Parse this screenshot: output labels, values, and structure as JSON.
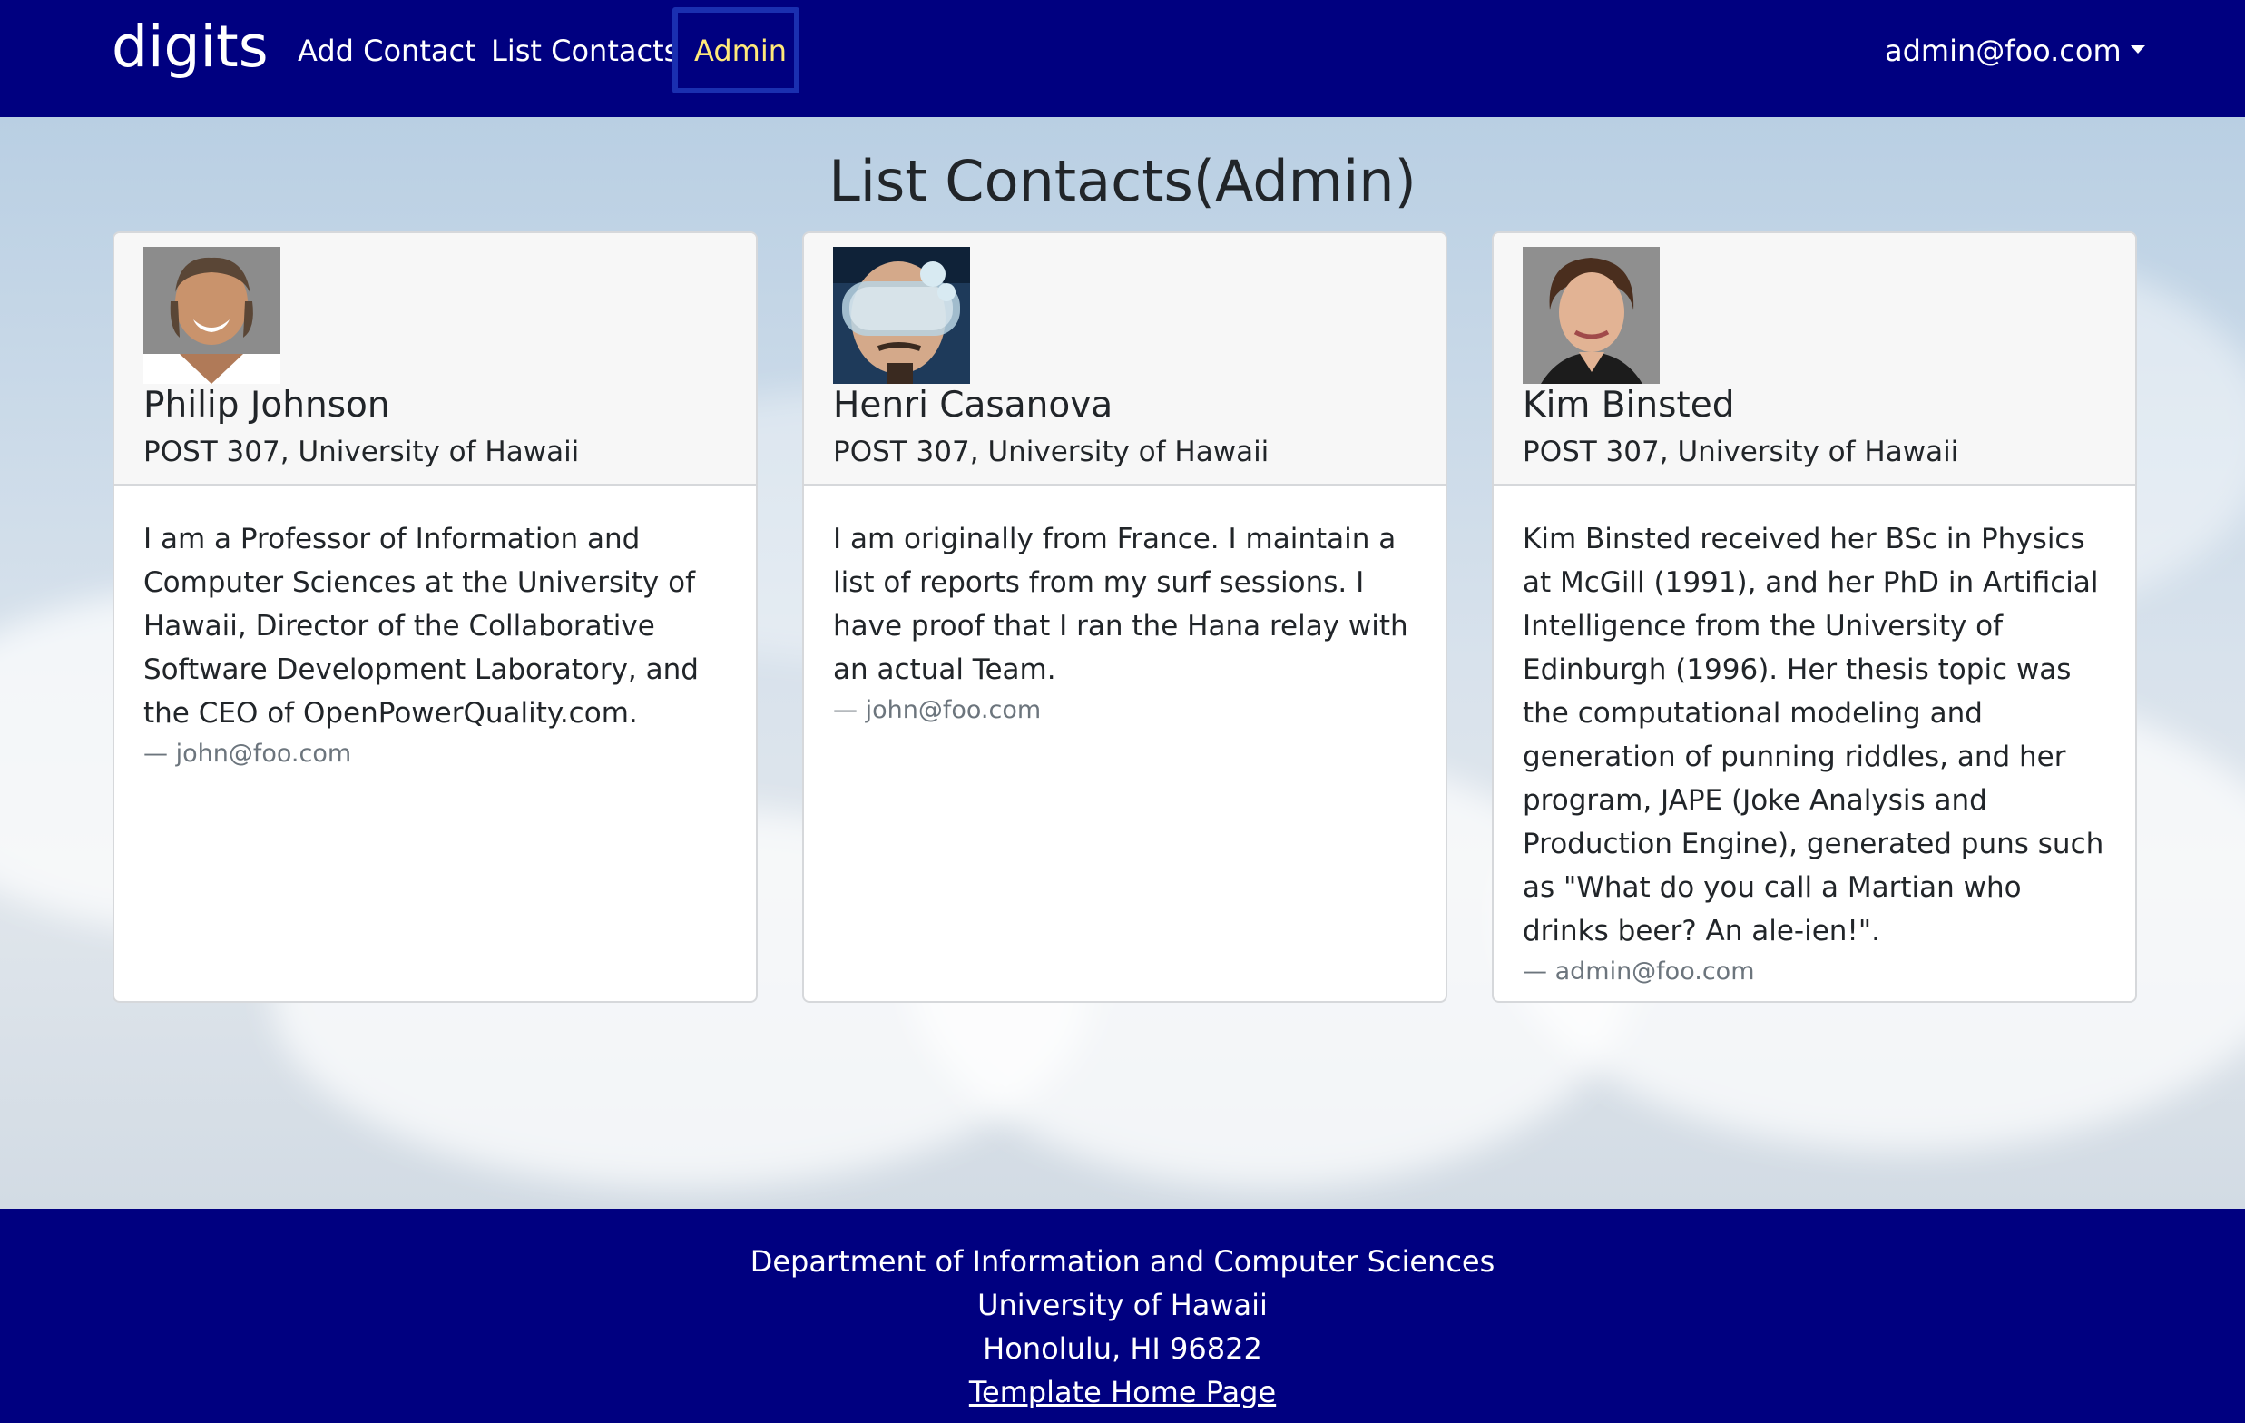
{
  "navbar": {
    "brand": "digits",
    "links": [
      "Add Contact",
      "List Contacts",
      "Admin"
    ],
    "user": "admin@foo.com"
  },
  "page": {
    "title": "List Contacts(Admin)"
  },
  "contacts": [
    {
      "name": "Philip Johnson",
      "address": "POST 307, University of Hawaii",
      "description": "I am a Professor of Information and Computer Sciences at the University of Hawaii, Director of the Collaborative Software Development Laboratory, and the CEO of OpenPowerQuality.com.",
      "owner": "— john@foo.com"
    },
    {
      "name": "Henri Casanova",
      "address": "POST 307, University of Hawaii",
      "description": "I am originally from France. I maintain a list of reports from my surf sessions. I have proof that I ran the Hana relay with an actual Team.",
      "owner": "— john@foo.com"
    },
    {
      "name": "Kim Binsted",
      "address": "POST 307, University of Hawaii",
      "description": "Kim Binsted received her BSc in Physics at McGill (1991), and her PhD in Artificial Intelligence from the University of Edinburgh (1996). Her thesis topic was the computational modeling and generation of punning riddles, and her program, JAPE (Joke Analysis and Production Engine), generated puns such as \"What do you call a Martian who drinks beer? An ale-ien!\".",
      "owner": "— admin@foo.com"
    }
  ],
  "footer": {
    "lines": [
      "Department of Information and Computer Sciences",
      "University of Hawaii",
      "Honolulu, HI 96822"
    ],
    "link": "Template Home Page"
  },
  "colors": {
    "navbar": "#000080",
    "active_link": "#ffe97a",
    "footer": "#000080"
  }
}
